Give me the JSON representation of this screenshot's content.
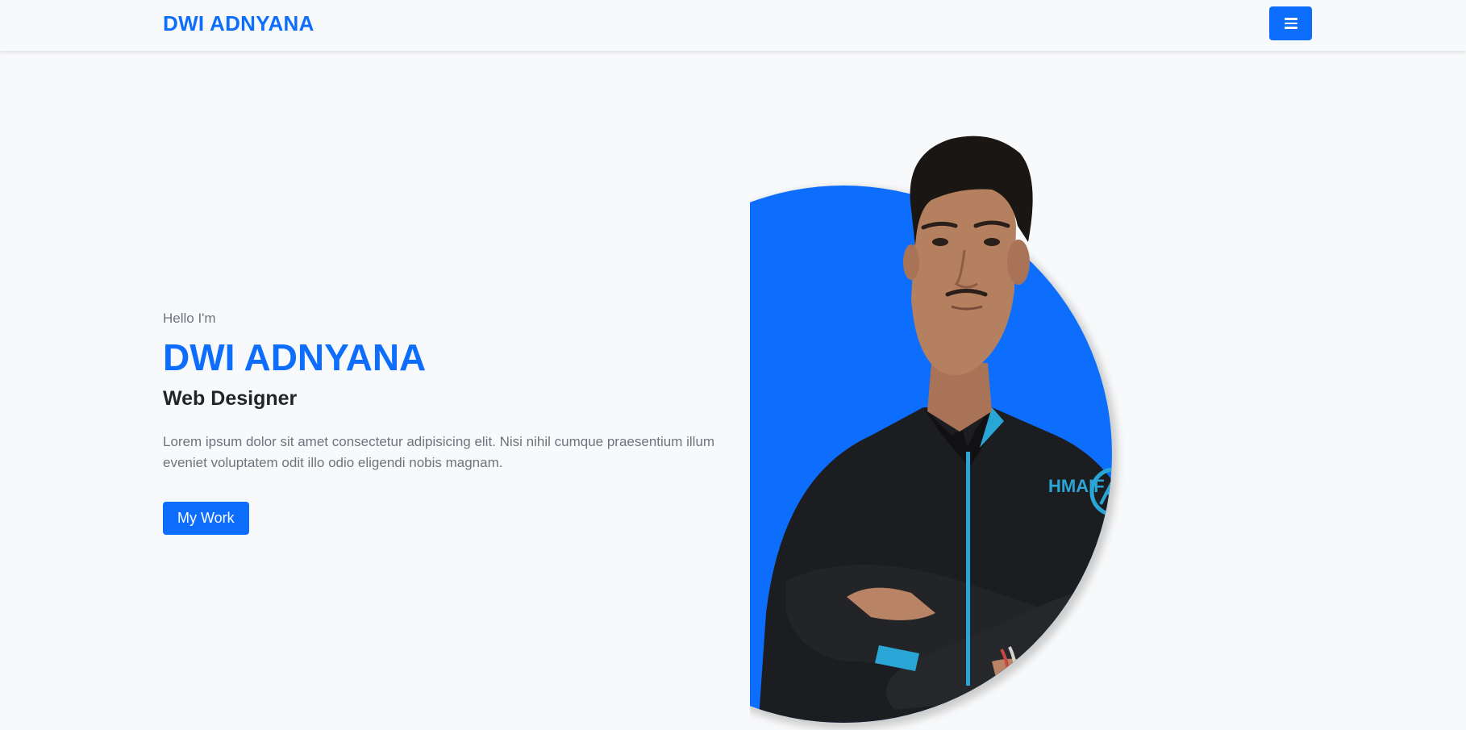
{
  "navbar": {
    "brand": "DWI ADNYANA",
    "toggle_icon": "hamburger-icon",
    "accent": "#0d6efd"
  },
  "hero": {
    "greeting": "Hello I'm",
    "name": "DWI ADNYANA",
    "role": "Web Designer",
    "description": "Lorem ipsum dolor sit amet consectetur adipisicing elit. Nisi nihil cumque praesentium illum eveniet voluptatem odit illo odio eligendi nobis magnam.",
    "button_label": "My Work"
  },
  "portrait": {
    "background_color": "#0d6efd",
    "shirt_logo": "HMAIF"
  }
}
